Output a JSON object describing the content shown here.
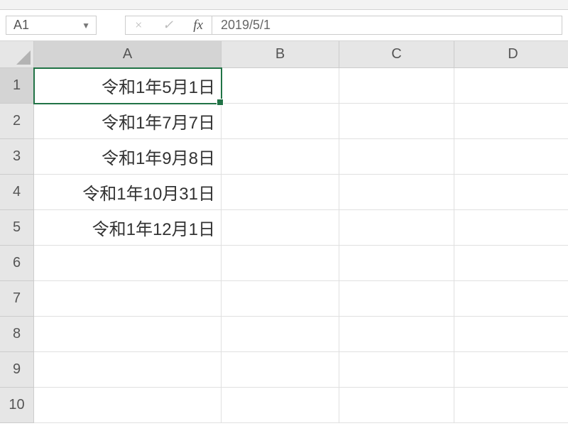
{
  "nameBox": {
    "value": "A1"
  },
  "formulaBar": {
    "cancel": "×",
    "confirm": "✓",
    "fx": "fx",
    "value": "2019/5/1"
  },
  "columns": [
    "A",
    "B",
    "C",
    "D"
  ],
  "activeColumn": "A",
  "activeRow": 1,
  "selectedCell": "A1",
  "rows": [
    {
      "num": "1",
      "A": "令和1年5月1日",
      "B": "",
      "C": "",
      "D": ""
    },
    {
      "num": "2",
      "A": "令和1年7月7日",
      "B": "",
      "C": "",
      "D": ""
    },
    {
      "num": "3",
      "A": "令和1年9月8日",
      "B": "",
      "C": "",
      "D": ""
    },
    {
      "num": "4",
      "A": "令和1年10月31日",
      "B": "",
      "C": "",
      "D": ""
    },
    {
      "num": "5",
      "A": "令和1年12月1日",
      "B": "",
      "C": "",
      "D": ""
    },
    {
      "num": "6",
      "A": "",
      "B": "",
      "C": "",
      "D": ""
    },
    {
      "num": "7",
      "A": "",
      "B": "",
      "C": "",
      "D": ""
    },
    {
      "num": "8",
      "A": "",
      "B": "",
      "C": "",
      "D": ""
    },
    {
      "num": "9",
      "A": "",
      "B": "",
      "C": "",
      "D": ""
    },
    {
      "num": "10",
      "A": "",
      "B": "",
      "C": "",
      "D": ""
    }
  ]
}
